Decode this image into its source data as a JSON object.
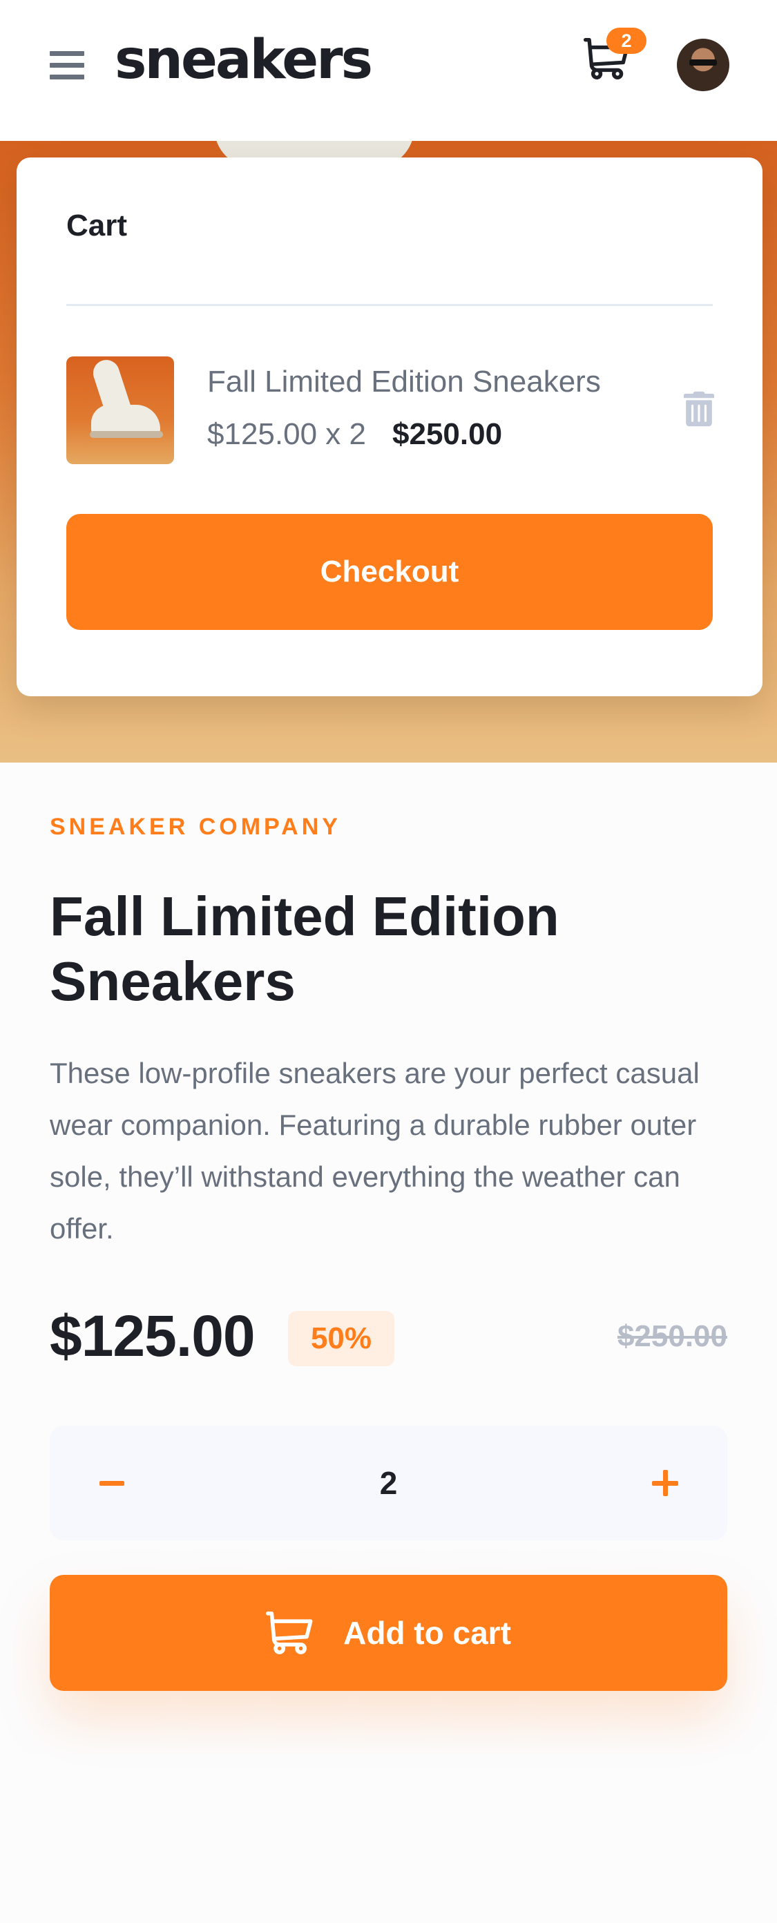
{
  "header": {
    "logo": "sneakers",
    "cart_count": "2"
  },
  "cart": {
    "title": "Cart",
    "item": {
      "name": "Fall Limited Edition Sneakers",
      "unit_price_qty": "$125.00 x 2",
      "total": "$250.00"
    },
    "checkout_label": "Checkout"
  },
  "product": {
    "company": "SNEAKER COMPANY",
    "title": "Fall Limited Edition Sneakers",
    "description": "These low-profile sneakers are your perfect casual wear companion. Featuring a durable rubber outer sole, they’ll withstand everything the weather can offer.",
    "price": "$125.00",
    "discount": "50%",
    "old_price": "$250.00",
    "quantity": "2",
    "add_to_cart_label": "Add to cart"
  },
  "colors": {
    "accent": "#ff7e1b",
    "accent_light": "#ffeee2",
    "dark_text": "#1d2026",
    "muted_text": "#69707d",
    "strike_text": "#b6bcc8",
    "qty_bg": "#f6f8fd"
  },
  "icons": {
    "menu": "menu-icon",
    "cart": "cart-icon",
    "trash": "trash-icon",
    "minus": "minus-icon",
    "plus": "plus-icon"
  }
}
